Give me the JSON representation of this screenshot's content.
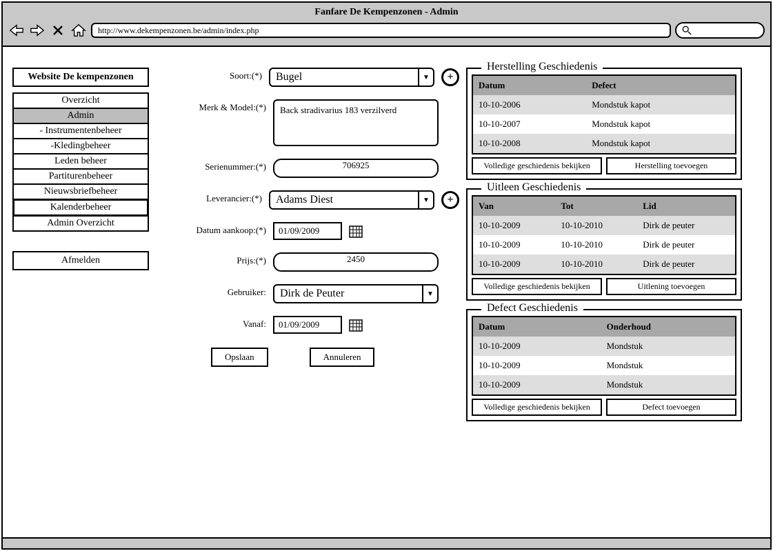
{
  "window_title": "Fanfare De Kempenzonen - Admin",
  "url": "http://www.dekempenzonen.be/admin/index.php",
  "sidebar": {
    "header": "Website De kempenzonen",
    "items": [
      {
        "label": "Overzicht",
        "active": false
      },
      {
        "label": "Admin",
        "active": true
      },
      {
        "label": "- Instrumentenbeheer",
        "active": false
      },
      {
        "label": "-Kledingbeheer",
        "active": false
      },
      {
        "label": "Leden beheer",
        "active": false
      },
      {
        "label": "Partiturenbeheer",
        "active": false
      },
      {
        "label": "Nieuwsbriefbeheer",
        "active": false
      },
      {
        "label": "Kalenderbeheer",
        "active": false,
        "boxed": true
      },
      {
        "label": "Admin Overzicht",
        "active": false
      }
    ],
    "logout": "Afmelden"
  },
  "form": {
    "soort": {
      "label": "Soort:(*)",
      "value": "Bugel"
    },
    "merk": {
      "label": "Merk & Model:(*)",
      "value": "Back stradivarius 183 verzilverd"
    },
    "serie": {
      "label": "Serienummer:(*)",
      "value": "706925"
    },
    "leverancier": {
      "label": "Leverancier:(*)",
      "value": "Adams Diest"
    },
    "datum": {
      "label": "Datum aankoop:(*)",
      "value": "01/09/2009"
    },
    "prijs": {
      "label": "Prijs:(*)",
      "value": "2450"
    },
    "gebruiker": {
      "label": "Gebruiker:",
      "value": "Dirk de Peuter"
    },
    "vanaf": {
      "label": "Vanaf:",
      "value": "01/09/2009"
    },
    "save": "Opslaan",
    "cancel": "Annuleren"
  },
  "herstelling": {
    "title": "Herstelling Geschiedenis",
    "cols": [
      "Datum",
      "Defect"
    ],
    "rows": [
      [
        "10-10-2006",
        "Mondstuk kapot"
      ],
      [
        "10-10-2007",
        "Mondstuk kapot"
      ],
      [
        "10-10-2008",
        "Mondstuk kapot"
      ]
    ],
    "view": "Volledige geschiedenis bekijken",
    "add": "Herstelling toevoegen"
  },
  "uitleen": {
    "title": "Uitleen Geschiedenis",
    "cols": [
      "Van",
      "Tot",
      "Lid"
    ],
    "rows": [
      [
        "10-10-2009",
        "10-10-2010",
        "Dirk de peuter"
      ],
      [
        "10-10-2009",
        "10-10-2010",
        "Dirk de peuter"
      ],
      [
        "10-10-2009",
        "10-10-2010",
        "Dirk de peuter"
      ]
    ],
    "view": "Volledige geschiedenis bekijken",
    "add": "Uitlening toevoegen"
  },
  "defect": {
    "title": "Defect Geschiedenis",
    "cols": [
      "Datum",
      "Onderhoud"
    ],
    "rows": [
      [
        "10-10-2009",
        "Mondstuk"
      ],
      [
        "10-10-2009",
        "Mondstuk"
      ],
      [
        "10-10-2009",
        "Mondstuk"
      ]
    ],
    "view": "Volledige geschiedenis bekijken",
    "add": "Defect toevoegen"
  }
}
